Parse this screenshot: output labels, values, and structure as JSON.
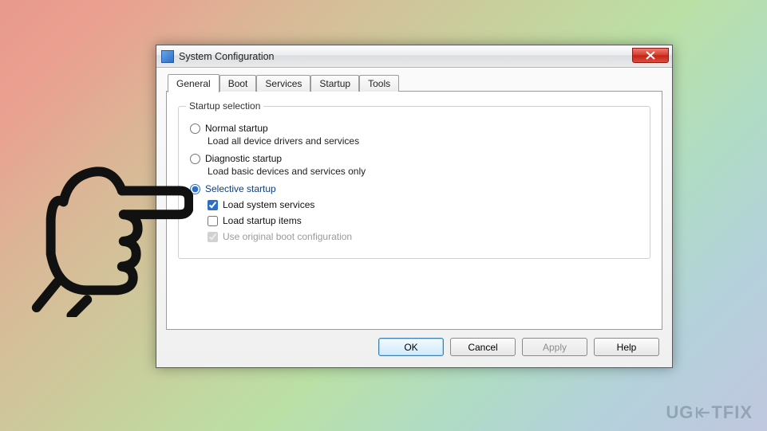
{
  "window": {
    "title": "System Configuration",
    "close_tooltip": "Close"
  },
  "tabs": [
    {
      "label": "General",
      "active": true
    },
    {
      "label": "Boot",
      "active": false
    },
    {
      "label": "Services",
      "active": false
    },
    {
      "label": "Startup",
      "active": false
    },
    {
      "label": "Tools",
      "active": false
    }
  ],
  "group": {
    "legend": "Startup selection",
    "normal": {
      "label": "Normal startup",
      "desc": "Load all device drivers and services",
      "checked": false
    },
    "diagnostic": {
      "label": "Diagnostic startup",
      "desc": "Load basic devices and services only",
      "checked": false
    },
    "selective": {
      "label": "Selective startup",
      "checked": true,
      "load_system": {
        "label": "Load system services",
        "checked": true,
        "enabled": true
      },
      "load_startup": {
        "label": "Load startup items",
        "checked": false,
        "enabled": true
      },
      "orig_boot": {
        "label": "Use original boot configuration",
        "checked": true,
        "enabled": false
      }
    }
  },
  "buttons": {
    "ok": "OK",
    "cancel": "Cancel",
    "apply": "Apply",
    "help": "Help"
  },
  "watermark": {
    "left": "UG",
    "right": "TFIX"
  }
}
